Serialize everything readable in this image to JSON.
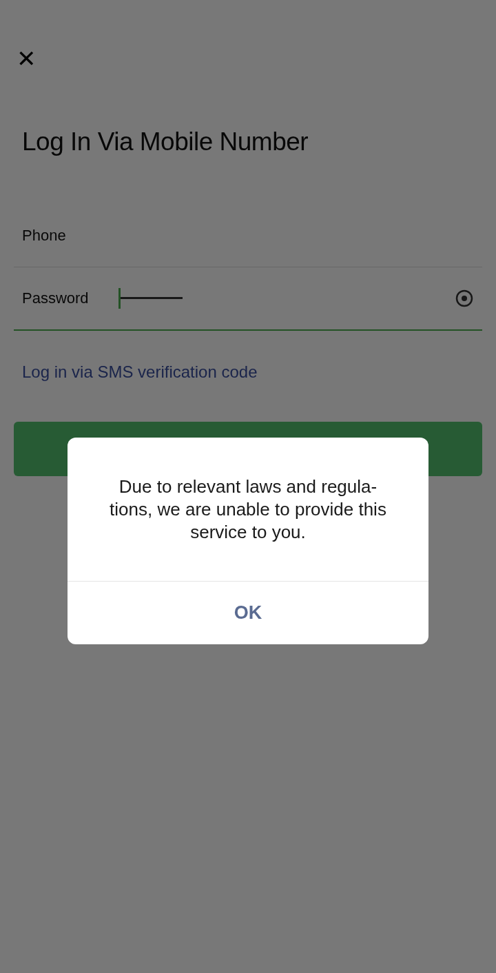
{
  "screen": {
    "close_label": "✕",
    "title": "Log In Via Mobile Number"
  },
  "fields": [
    {
      "label": "Phone",
      "kind": "text",
      "focused": false
    },
    {
      "label": "Password",
      "kind": "password",
      "focused": true
    }
  ],
  "sms_link": "Log in via SMS verification code",
  "dialog": {
    "message": "Due to relevant laws and regula-tions, we are unable to provide this service to you.",
    "button": "OK"
  }
}
